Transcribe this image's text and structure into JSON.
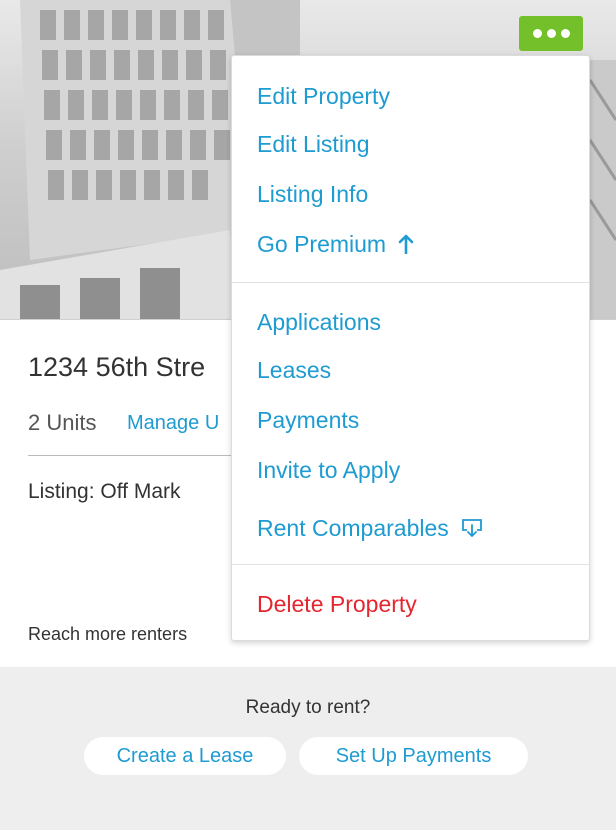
{
  "card": {
    "address": "1234 56th Stre",
    "units": "2 Units",
    "manage_link": "Manage U",
    "listing_status": "Listing: Off Mark",
    "reach_text": "Reach more renters",
    "footer": {
      "ready_text": "Ready to rent?",
      "create_lease": "Create a Lease",
      "setup_payments": "Set Up Payments"
    }
  },
  "menu": {
    "edit_property": "Edit Property",
    "edit_listing": "Edit Listing",
    "listing_info": "Listing Info",
    "go_premium": "Go Premium",
    "applications": "Applications",
    "leases": "Leases",
    "payments": "Payments",
    "invite_to_apply": "Invite to Apply",
    "rent_comparables": "Rent Comparables",
    "delete_property": "Delete Property"
  },
  "icons": {
    "more": "more-icon",
    "arrow_up": "arrow-up-icon",
    "download": "download-icon"
  },
  "colors": {
    "accent": "#1e9bd1",
    "more_button": "#74c02a",
    "danger": "#e5262f",
    "footer_bg": "#eeeeee"
  }
}
